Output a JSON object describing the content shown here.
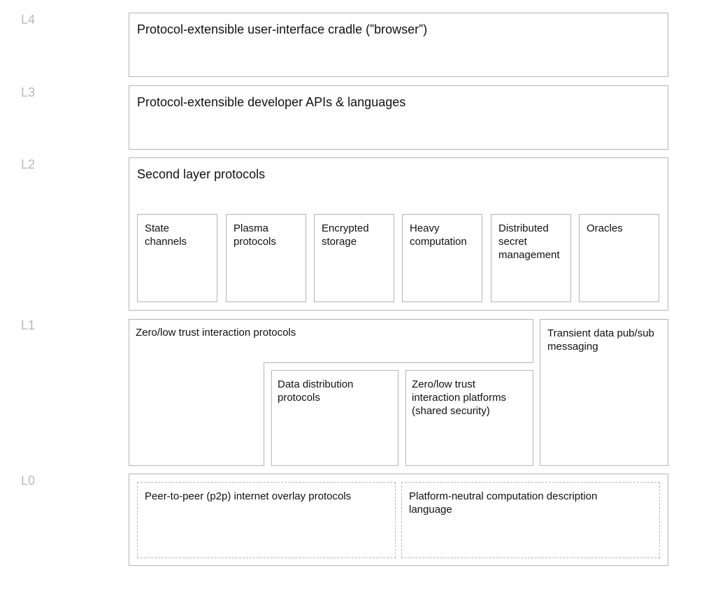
{
  "levels": {
    "l4": "L4",
    "l3": "L3",
    "l2": "L2",
    "l1": "L1",
    "l0": "L0"
  },
  "l4": {
    "title": "Protocol-extensible user-interface cradle (”browser”)"
  },
  "l3": {
    "title": "Protocol-extensible developer APIs & languages"
  },
  "l2": {
    "title": "Second layer protocols",
    "items": [
      "State channels",
      "Plasma protocols",
      "Encrypted storage",
      "Heavy computation",
      "Distributed secret management",
      "Oracles"
    ]
  },
  "l1": {
    "zero_trust": "Zero/low trust interaction protocols",
    "data_distribution": "Data distribution protocols",
    "platforms": "Zero/low trust interaction platforms (shared security)",
    "transient": "Transient data pub/sub messaging"
  },
  "l0": {
    "p2p": "Peer-to-peer (p2p) internet overlay protocols",
    "neutral": "Platform-neutral computation description language"
  }
}
